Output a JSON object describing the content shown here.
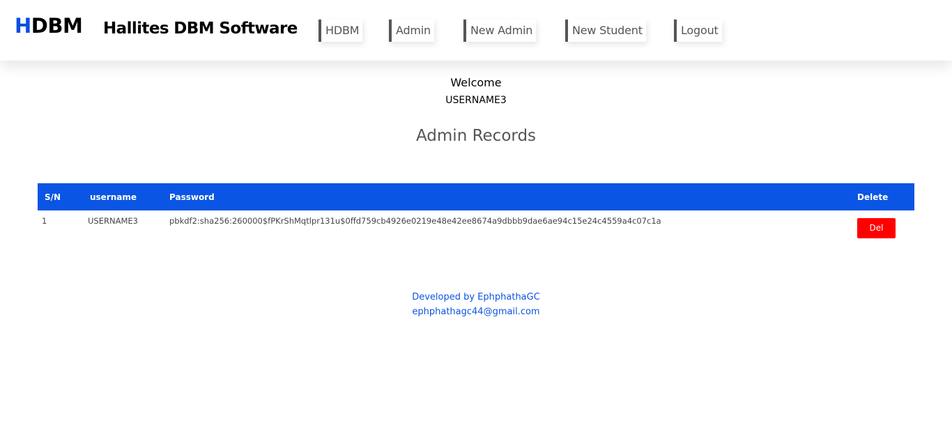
{
  "header": {
    "logo_first": "H",
    "logo_rest": "DBM",
    "brand_title": "Hallites DBM Software",
    "nav": [
      {
        "label": "HDBM"
      },
      {
        "label": "Admin"
      },
      {
        "label": "New Admin"
      },
      {
        "label": "New Student"
      },
      {
        "label": "Logout"
      }
    ]
  },
  "welcome": {
    "greeting": "Welcome",
    "username": "USERNAME3"
  },
  "section_title": "Admin Records",
  "table": {
    "headers": {
      "sn": "S/N",
      "username": "username",
      "password": "Password",
      "delete": "Delete"
    },
    "rows": [
      {
        "sn": "1",
        "username": "USERNAME3",
        "password": "pbkdf2:sha256:260000$fPKrShMqtlpr131u$0ffd759cb4926e0219e48e42ee8674a9dbbb9dae6ae94c15e24c4559a4c07c1a",
        "delete_label": "Del"
      }
    ]
  },
  "footer": {
    "developer": "Developed by EphphathaGC",
    "email": "ephphathagc44@gmail.com"
  },
  "colors": {
    "accent": "#0a55e3",
    "delete": "#ff0000",
    "nav_text": "#555555"
  }
}
